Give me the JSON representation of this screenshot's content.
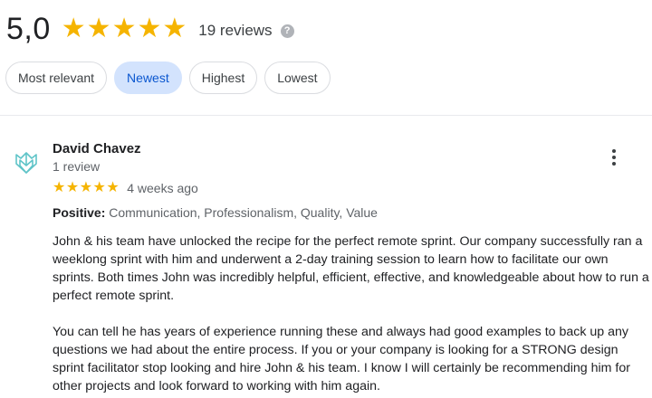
{
  "summary": {
    "rating": "5,0",
    "stars": 5,
    "review_count": "19 reviews",
    "help_icon_glyph": "?"
  },
  "sort_chips": [
    {
      "label": "Most relevant",
      "active": false
    },
    {
      "label": "Newest",
      "active": true
    },
    {
      "label": "Highest",
      "active": false
    },
    {
      "label": "Lowest",
      "active": false
    }
  ],
  "review": {
    "author": "David Chavez",
    "author_meta": "1 review",
    "stars": 5,
    "date": "4 weeks ago",
    "positive_label": "Positive:",
    "positive_values": "Communication, Professionalism, Quality, Value",
    "paragraphs": [
      "John & his team have unlocked the recipe for the perfect remote sprint.  Our company successfully ran a weeklong sprint with him and underwent a 2-day training session to learn how to facilitate our own sprints.  Both times John was incredibly helpful, efficient, effective, and knowledgeable about how to run a perfect remote sprint.",
      "You can tell he has years of experience running these and always had good examples to back up any questions we had about the entire process.  If you or your company is looking for a STRONG design sprint facilitator stop looking and hire John & his team.  I know I will certainly be recommending him for other projects and look forward to working with him again."
    ]
  },
  "colors": {
    "star": "#f5b400",
    "active_chip_bg": "#d3e3fd",
    "active_chip_text": "#0b57d0",
    "avatar_logo": "#5fc4c8"
  },
  "icons": {
    "help": "help-circle-icon",
    "more": "more-vertical-icon",
    "avatar": "avatar-logo-icon",
    "star": "star-icon"
  }
}
